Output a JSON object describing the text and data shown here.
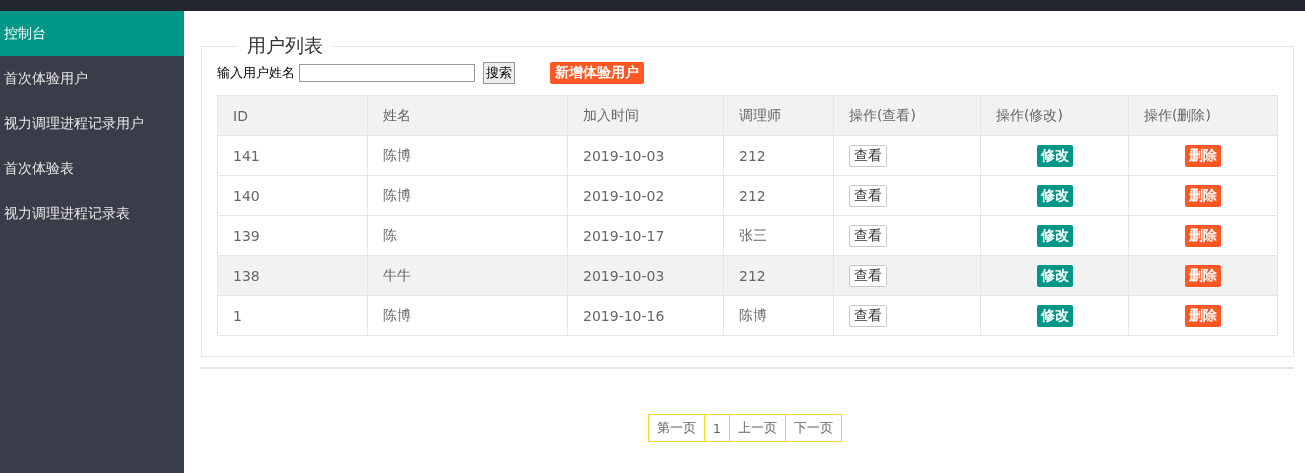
{
  "sidebar": {
    "items": [
      {
        "label": "控制台",
        "selected": true
      },
      {
        "label": "首次体验用户",
        "selected": false
      },
      {
        "label": "视力调理进程记录用户",
        "selected": false
      },
      {
        "label": "首次体验表",
        "selected": false
      },
      {
        "label": "视力调理进程记录表",
        "selected": false
      }
    ]
  },
  "panel": {
    "title": "用户列表",
    "search": {
      "label": "输入用户姓名",
      "button": "搜索"
    },
    "add_button": "新增体验用户"
  },
  "table": {
    "columns": [
      "ID",
      "姓名",
      "加入时间",
      "调理师",
      "操作(查看)",
      "操作(修改)",
      "操作(删除)"
    ],
    "rows": [
      {
        "cells": [
          "141",
          "陈博",
          "2019-10-03",
          "212"
        ],
        "view": "查看",
        "edit": "修改",
        "delete": "删除",
        "selected": false
      },
      {
        "cells": [
          "140",
          "陈博",
          "2019-10-02",
          "212"
        ],
        "view": "查看",
        "edit": "修改",
        "delete": "删除",
        "selected": false
      },
      {
        "cells": [
          "139",
          "陈",
          "2019-10-17",
          "张三"
        ],
        "view": "查看",
        "edit": "修改",
        "delete": "删除",
        "selected": false
      },
      {
        "cells": [
          "138",
          "牛牛",
          "2019-10-03",
          "212"
        ],
        "view": "查看",
        "edit": "修改",
        "delete": "删除",
        "selected": true
      },
      {
        "cells": [
          "1",
          "陈博",
          "2019-10-16",
          "陈博"
        ],
        "view": "查看",
        "edit": "修改",
        "delete": "删除",
        "selected": false
      }
    ]
  },
  "pagination": [
    "第一页",
    "1",
    "上一页",
    "下一页"
  ]
}
